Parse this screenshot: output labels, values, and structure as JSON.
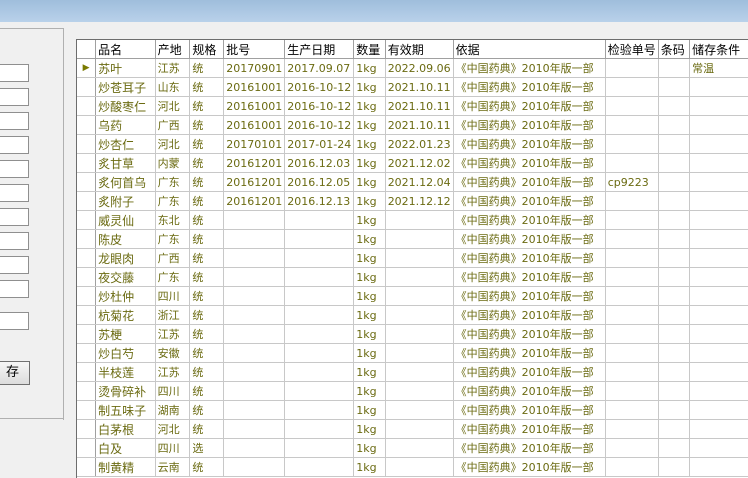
{
  "left_panel": {
    "save_label": "存"
  },
  "grid": {
    "selected_row_marker": "▶",
    "columns": [
      "品名",
      "产地",
      "规格",
      "批号",
      "生产日期",
      "数量",
      "有效期",
      "依据",
      "检验单号",
      "条码",
      "储存条件"
    ],
    "rows": [
      [
        "苏叶",
        "江苏",
        "统",
        "20170901",
        "2017.09.07",
        "1kg",
        "2022.09.06",
        "《中国药典》2010年版一部",
        "",
        "",
        "常温"
      ],
      [
        "炒苍耳子",
        "山东",
        "统",
        "20161001",
        "2016-10-12",
        "1kg",
        "2021.10.11",
        "《中国药典》2010年版一部",
        "",
        "",
        ""
      ],
      [
        "炒酸枣仁",
        "河北",
        "统",
        "20161001",
        "2016-10-12",
        "1kg",
        "2021.10.11",
        "《中国药典》2010年版一部",
        "",
        "",
        ""
      ],
      [
        "乌药",
        "广西",
        "统",
        "20161001",
        "2016-10-12",
        "1kg",
        "2021.10.11",
        "《中国药典》2010年版一部",
        "",
        "",
        ""
      ],
      [
        "炒杏仁",
        "河北",
        "统",
        "20170101",
        "2017-01-24",
        "1kg",
        "2022.01.23",
        "《中国药典》2010年版一部",
        "",
        "",
        ""
      ],
      [
        "炙甘草",
        "内蒙",
        "统",
        "20161201",
        "2016.12.03",
        "1kg",
        "2021.12.02",
        "《中国药典》2010年版一部",
        "",
        "",
        ""
      ],
      [
        "炙何首乌",
        "广东",
        "统",
        "20161201",
        "2016.12.05",
        "1kg",
        "2021.12.04",
        "《中国药典》2010年版一部",
        "cp9223",
        "",
        ""
      ],
      [
        "炙附子",
        "广东",
        "统",
        "20161201",
        "2016.12.13",
        "1kg",
        "2021.12.12",
        "《中国药典》2010年版一部",
        "",
        "",
        ""
      ],
      [
        "威灵仙",
        "东北",
        "统",
        "",
        "",
        "1kg",
        "",
        "《中国药典》2010年版一部",
        "",
        "",
        ""
      ],
      [
        "陈皮",
        "广东",
        "统",
        "",
        "",
        "1kg",
        "",
        "《中国药典》2010年版一部",
        "",
        "",
        ""
      ],
      [
        "龙眼肉",
        "广西",
        "统",
        "",
        "",
        "1kg",
        "",
        "《中国药典》2010年版一部",
        "",
        "",
        ""
      ],
      [
        "夜交藤",
        "广东",
        "统",
        "",
        "",
        "1kg",
        "",
        "《中国药典》2010年版一部",
        "",
        "",
        ""
      ],
      [
        "炒杜仲",
        "四川",
        "统",
        "",
        "",
        "1kg",
        "",
        "《中国药典》2010年版一部",
        "",
        "",
        ""
      ],
      [
        "杭菊花",
        "浙江",
        "统",
        "",
        "",
        "1kg",
        "",
        "《中国药典》2010年版一部",
        "",
        "",
        ""
      ],
      [
        "苏梗",
        "江苏",
        "统",
        "",
        "",
        "1kg",
        "",
        "《中国药典》2010年版一部",
        "",
        "",
        ""
      ],
      [
        "炒白芍",
        "安徽",
        "统",
        "",
        "",
        "1kg",
        "",
        "《中国药典》2010年版一部",
        "",
        "",
        ""
      ],
      [
        "半枝莲",
        "江苏",
        "统",
        "",
        "",
        "1kg",
        "",
        "《中国药典》2010年版一部",
        "",
        "",
        ""
      ],
      [
        "烫骨碎补",
        "四川",
        "统",
        "",
        "",
        "1kg",
        "",
        "《中国药典》2010年版一部",
        "",
        "",
        ""
      ],
      [
        "制五味子",
        "湖南",
        "统",
        "",
        "",
        "1kg",
        "",
        "《中国药典》2010年版一部",
        "",
        "",
        ""
      ],
      [
        "白茅根",
        "河北",
        "统",
        "",
        "",
        "1kg",
        "",
        "《中国药典》2010年版一部",
        "",
        "",
        ""
      ],
      [
        "白及",
        "四川",
        "选",
        "",
        "",
        "1kg",
        "",
        "《中国药典》2010年版一部",
        "",
        "",
        ""
      ],
      [
        "制黄精",
        "云南",
        "统",
        "",
        "",
        "1kg",
        "",
        "《中国药典》2010年版一部",
        "",
        "",
        ""
      ]
    ]
  }
}
